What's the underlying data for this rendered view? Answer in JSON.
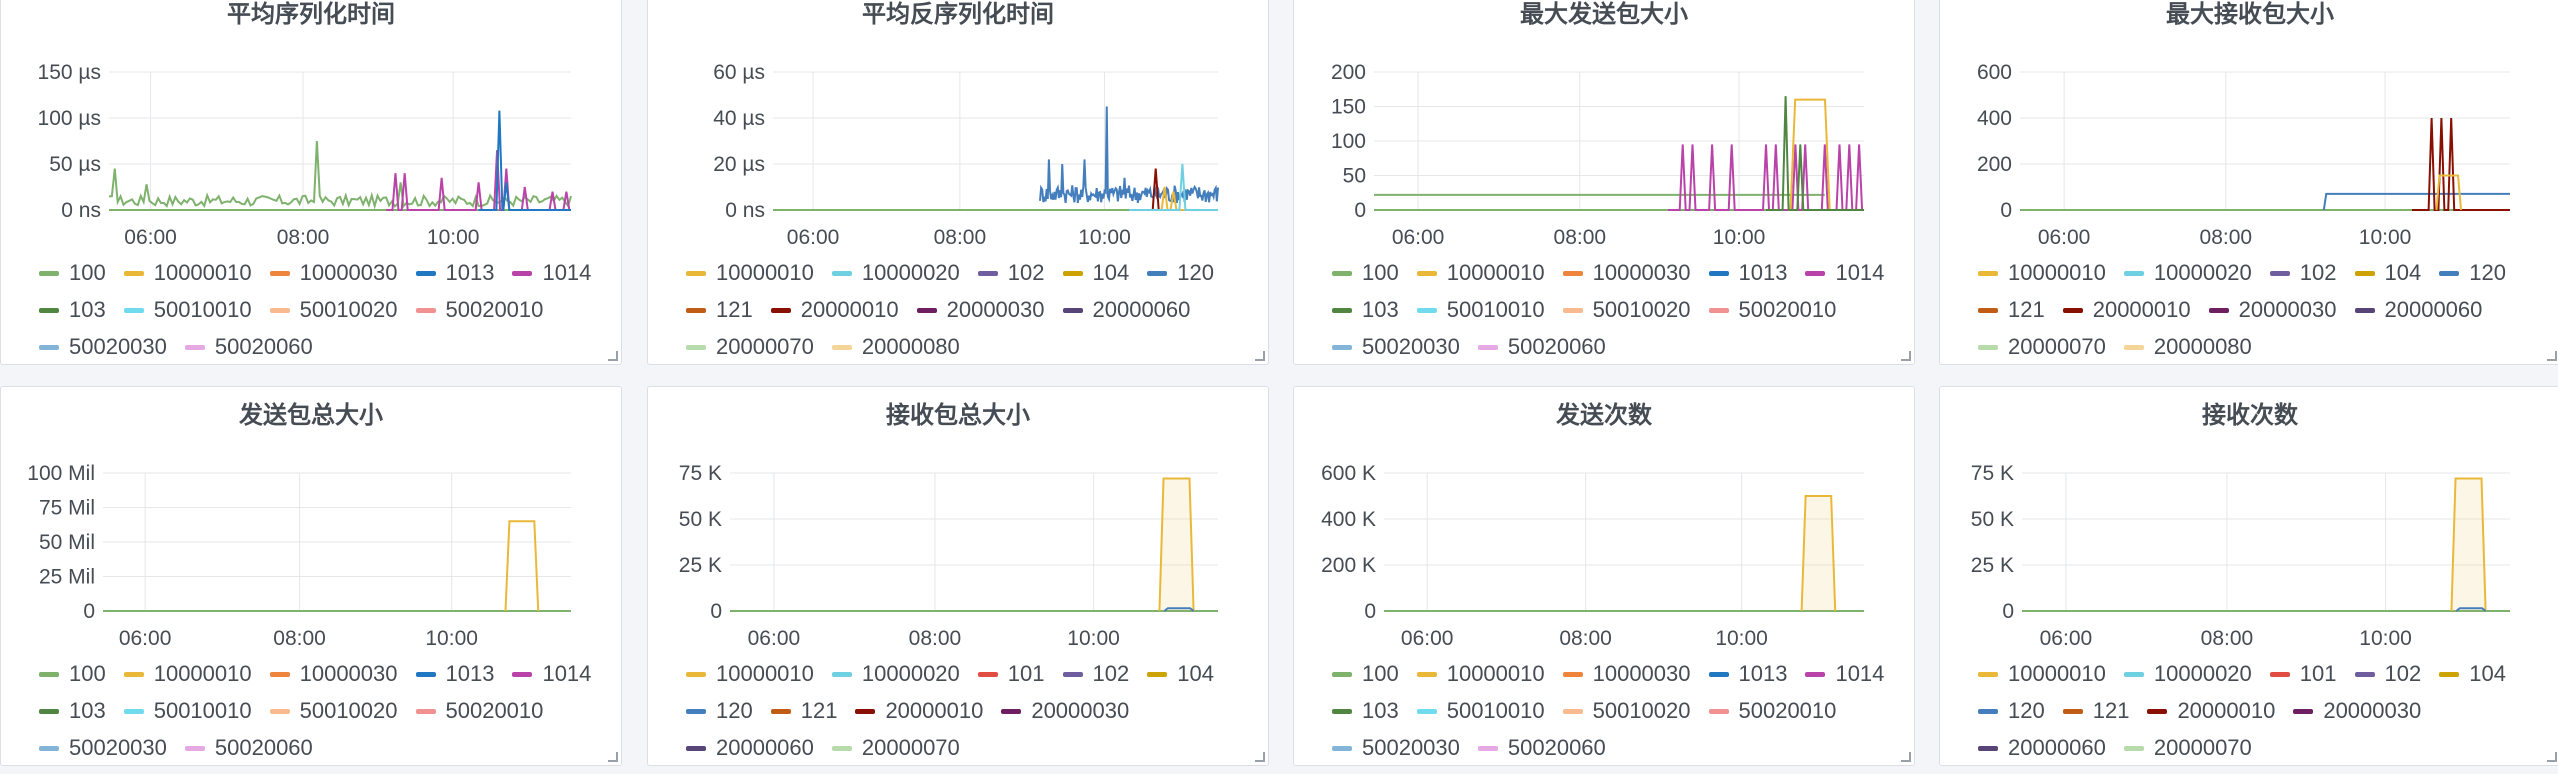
{
  "colors": {
    "100": "#7eb26d",
    "10000010": "#eab839",
    "10000020": "#6ed0e0",
    "10000030": "#ef843c",
    "1013": "#1f78c1",
    "1014": "#ba43a9",
    "103": "#508642",
    "50010010": "#70dbed",
    "50010020": "#f9ba8f",
    "50020010": "#f29191",
    "50020030": "#82b5d8",
    "50020060": "#e5a8e2",
    "101": "#e24d42",
    "102": "#705da0",
    "104": "#cca300",
    "120": "#447ebc",
    "121": "#c15c17",
    "20000010": "#890f02",
    "20000030": "#6d1f62",
    "20000060": "#584477",
    "20000070": "#b7dbab",
    "20000080": "#f4d598"
  },
  "panels": [
    {
      "title": "平均序列化时间",
      "legend": [
        "100",
        "10000010",
        "10000030",
        "1013",
        "1014",
        "103",
        "50010010",
        "50010020",
        "50020010",
        "50020030",
        "50020060"
      ],
      "chart_data": {
        "type": "line",
        "yticks": [
          "150 µs",
          "100 µs",
          "50 µs",
          "0 ns"
        ],
        "xticks": [
          "06:00",
          "08:00",
          "10:00"
        ],
        "ylim": [
          0,
          150
        ],
        "unit": "µs",
        "series": [
          {
            "key": "100",
            "kind": "noise",
            "base": 10,
            "amp": 6,
            "start": 0,
            "end": 1,
            "spikes": [
              {
                "x": 0.01,
                "v": 45
              },
              {
                "x": 0.08,
                "v": 28
              },
              {
                "x": 0.45,
                "v": 75
              },
              {
                "x": 0.63,
                "v": 30
              }
            ]
          },
          {
            "key": "1014",
            "kind": "spikes",
            "start": 0.6,
            "end": 1,
            "spikes": [
              {
                "x": 0.62,
                "v": 40
              },
              {
                "x": 0.64,
                "v": 40
              },
              {
                "x": 0.72,
                "v": 35
              },
              {
                "x": 0.8,
                "v": 30
              },
              {
                "x": 0.84,
                "v": 65
              },
              {
                "x": 0.86,
                "v": 45
              },
              {
                "x": 0.9,
                "v": 25
              },
              {
                "x": 0.96,
                "v": 20
              },
              {
                "x": 0.99,
                "v": 20
              }
            ]
          },
          {
            "key": "1013",
            "kind": "spikes",
            "start": 0.8,
            "end": 1,
            "spikes": [
              {
                "x": 0.845,
                "v": 108
              },
              {
                "x": 0.86,
                "v": 30
              }
            ]
          }
        ]
      }
    },
    {
      "title": "平均反序列化时间",
      "legend": [
        "10000010",
        "10000020",
        "102",
        "104",
        "120",
        "121",
        "20000010",
        "20000030",
        "20000060",
        "20000070",
        "20000080"
      ],
      "chart_data": {
        "type": "line",
        "yticks": [
          "60 µs",
          "40 µs",
          "20 µs",
          "0 ns"
        ],
        "xticks": [
          "06:00",
          "08:00",
          "10:00"
        ],
        "ylim": [
          0,
          60
        ],
        "unit": "µs",
        "series": [
          {
            "key": "120",
            "kind": "noise",
            "base": 7,
            "amp": 4,
            "start": 0.6,
            "end": 1,
            "spikes": [
              {
                "x": 0.62,
                "v": 22
              },
              {
                "x": 0.65,
                "v": 20
              },
              {
                "x": 0.7,
                "v": 22
              },
              {
                "x": 0.75,
                "v": 45
              },
              {
                "x": 0.79,
                "v": 14
              }
            ]
          },
          {
            "key": "20000010",
            "kind": "spikes",
            "start": 0.8,
            "end": 1,
            "spikes": [
              {
                "x": 0.86,
                "v": 18
              }
            ]
          },
          {
            "key": "10000010",
            "kind": "spikes",
            "start": 0.8,
            "end": 1,
            "spikes": [
              {
                "x": 0.88,
                "v": 10
              },
              {
                "x": 0.9,
                "v": 8
              }
            ]
          },
          {
            "key": "10000020",
            "kind": "spikes",
            "start": 0.8,
            "end": 1,
            "spikes": [
              {
                "x": 0.92,
                "v": 20
              }
            ]
          }
        ]
      }
    },
    {
      "title": "最大发送包大小",
      "legend": [
        "100",
        "10000010",
        "10000030",
        "1013",
        "1014",
        "103",
        "50010010",
        "50010020",
        "50020010",
        "50020030",
        "50020060"
      ],
      "chart_data": {
        "type": "line",
        "yticks": [
          "200",
          "150",
          "100",
          "50",
          "0"
        ],
        "xticks": [
          "06:00",
          "08:00",
          "10:00"
        ],
        "ylim": [
          0,
          200
        ],
        "series": [
          {
            "key": "100",
            "kind": "flat",
            "base": 22,
            "start": 0,
            "end": 0.92
          },
          {
            "key": "1014",
            "kind": "spikes",
            "start": 0.6,
            "end": 1,
            "spikes": [
              {
                "x": 0.63,
                "v": 95
              },
              {
                "x": 0.65,
                "v": 95
              },
              {
                "x": 0.69,
                "v": 95
              },
              {
                "x": 0.73,
                "v": 95
              },
              {
                "x": 0.8,
                "v": 95
              },
              {
                "x": 0.82,
                "v": 95
              },
              {
                "x": 0.86,
                "v": 95
              },
              {
                "x": 0.88,
                "v": 95
              },
              {
                "x": 0.92,
                "v": 95
              },
              {
                "x": 0.95,
                "v": 95
              },
              {
                "x": 0.97,
                "v": 95
              },
              {
                "x": 0.99,
                "v": 95
              }
            ]
          },
          {
            "key": "10000010",
            "kind": "block",
            "start": 0.85,
            "end": 0.93,
            "v": 160
          },
          {
            "key": "103",
            "kind": "spikes",
            "start": 0.8,
            "end": 1,
            "spikes": [
              {
                "x": 0.84,
                "v": 165
              },
              {
                "x": 0.87,
                "v": 95
              }
            ]
          }
        ]
      }
    },
    {
      "title": "最大接收包大小",
      "legend": [
        "10000010",
        "10000020",
        "102",
        "104",
        "120",
        "121",
        "20000010",
        "20000030",
        "20000060",
        "20000070",
        "20000080"
      ],
      "chart_data": {
        "type": "line",
        "yticks": [
          "600",
          "400",
          "200",
          "0"
        ],
        "xticks": [
          "06:00",
          "08:00",
          "10:00"
        ],
        "ylim": [
          0,
          600
        ],
        "series": [
          {
            "key": "120",
            "kind": "step",
            "base": 70,
            "start": 0.62,
            "end": 1
          },
          {
            "key": "20000010",
            "kind": "spikes",
            "start": 0.8,
            "end": 1,
            "spikes": [
              {
                "x": 0.84,
                "v": 400
              },
              {
                "x": 0.86,
                "v": 400
              },
              {
                "x": 0.88,
                "v": 400
              }
            ]
          },
          {
            "key": "10000010",
            "kind": "block",
            "start": 0.85,
            "end": 0.9,
            "v": 150
          }
        ]
      }
    },
    {
      "title": "发送包总大小",
      "legend": [
        "100",
        "10000010",
        "10000030",
        "1013",
        "1014",
        "103",
        "50010010",
        "50010020",
        "50020010",
        "50020030",
        "50020060"
      ],
      "chart_data": {
        "type": "line",
        "yticks": [
          "100 Mil",
          "75 Mil",
          "50 Mil",
          "25 Mil",
          "0"
        ],
        "xticks": [
          "06:00",
          "08:00",
          "10:00"
        ],
        "ylim": [
          0,
          100
        ],
        "series": [
          {
            "key": "10000010",
            "kind": "block",
            "start": 0.86,
            "end": 0.93,
            "v": 65
          }
        ]
      }
    },
    {
      "title": "接收包总大小",
      "legend": [
        "10000010",
        "10000020",
        "101",
        "102",
        "104",
        "120",
        "121",
        "20000010",
        "20000030",
        "20000060",
        "20000070"
      ],
      "chart_data": {
        "type": "area",
        "yticks": [
          "75 K",
          "50 K",
          "25 K",
          "0"
        ],
        "xticks": [
          "06:00",
          "08:00",
          "10:00"
        ],
        "ylim": [
          0,
          75
        ],
        "series": [
          {
            "key": "10000010",
            "kind": "block",
            "start": 0.88,
            "end": 0.95,
            "v": 72,
            "fill": true
          },
          {
            "key": "120",
            "kind": "block",
            "start": 0.89,
            "end": 0.95,
            "v": 1.5
          }
        ]
      }
    },
    {
      "title": "发送次数",
      "legend": [
        "100",
        "10000010",
        "10000030",
        "1013",
        "1014",
        "103",
        "50010010",
        "50010020",
        "50020010",
        "50020030",
        "50020060"
      ],
      "chart_data": {
        "type": "area",
        "yticks": [
          "600 K",
          "400 K",
          "200 K",
          "0"
        ],
        "xticks": [
          "06:00",
          "08:00",
          "10:00"
        ],
        "ylim": [
          0,
          600
        ],
        "series": [
          {
            "key": "10000010",
            "kind": "block",
            "start": 0.87,
            "end": 0.94,
            "v": 500,
            "fill": true
          }
        ]
      }
    },
    {
      "title": "接收次数",
      "legend": [
        "10000010",
        "10000020",
        "101",
        "102",
        "104",
        "120",
        "121",
        "20000010",
        "20000030",
        "20000060",
        "20000070"
      ],
      "chart_data": {
        "type": "area",
        "yticks": [
          "75 K",
          "50 K",
          "25 K",
          "0"
        ],
        "xticks": [
          "06:00",
          "08:00",
          "10:00"
        ],
        "ylim": [
          0,
          75
        ],
        "series": [
          {
            "key": "10000010",
            "kind": "block",
            "start": 0.88,
            "end": 0.95,
            "v": 72,
            "fill": true
          },
          {
            "key": "120",
            "kind": "block",
            "start": 0.89,
            "end": 0.95,
            "v": 1.5
          }
        ]
      }
    }
  ]
}
